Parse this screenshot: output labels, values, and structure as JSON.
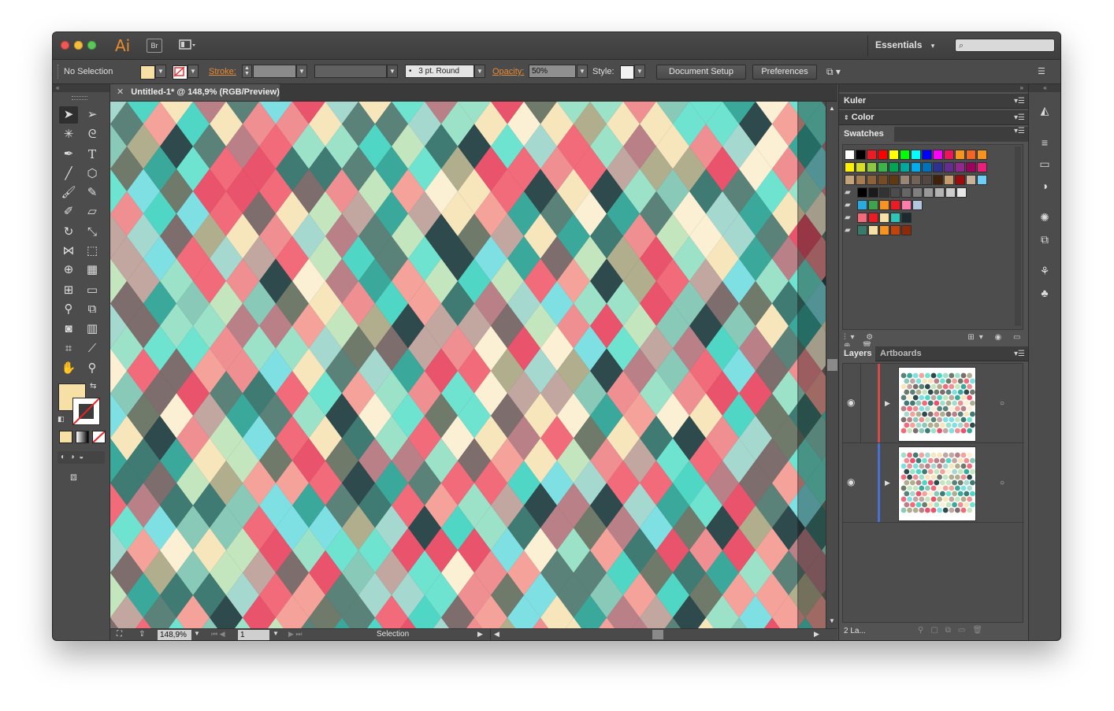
{
  "app": {
    "logo": "Ai",
    "bridge_label": "Br",
    "workspace": "Essentials",
    "workspace_arrow": "▾",
    "search_placeholder": ""
  },
  "control_bar": {
    "selection_status": "No Selection",
    "stroke_label": "Stroke:",
    "brush_label": "3 pt. Round",
    "opacity_label": "Opacity:",
    "opacity_value": "50%",
    "style_label": "Style:",
    "document_setup": "Document Setup",
    "preferences": "Preferences"
  },
  "document": {
    "tab_title": "Untitled-1* @ 148,9% (RGB/Preview)",
    "zoom": "148,9%",
    "artboard_number": "1",
    "status_tool": "Selection"
  },
  "panels": {
    "kuler": "Kuler",
    "color": "Color",
    "swatches": "Swatches",
    "layers_tab": "Layers",
    "artboards_tab": "Artboards",
    "layers_count": "2 La..."
  },
  "colors": {
    "fill_swatch": "#f6e0a5",
    "pattern": [
      "#f26b7a",
      "#ef8f92",
      "#f5a39a",
      "#e9536b",
      "#4fd6c4",
      "#6ee3d0",
      "#7fe0e4",
      "#9be2c9",
      "#c4e6be",
      "#f7e6bc",
      "#fbf0d4",
      "#c2a6a0",
      "#b98088",
      "#7d6d6d",
      "#5b8278",
      "#3f7a73",
      "#2f4a4d",
      "#6f7a6b",
      "#b1ae8e",
      "#3aa89a",
      "#88c9b8",
      "#a5d9d0"
    ],
    "swatch_rows": [
      [
        "#ffffff",
        "#000000",
        "#ed1c24",
        "#ff0000",
        "#ffff00",
        "#00ff00",
        "#00ffff",
        "#0000ff",
        "#ff00ff",
        "#ed145b",
        "#f7941d",
        "#f26522",
        "#f7941d"
      ],
      [
        "#fff200",
        "#d7df23",
        "#8dc63f",
        "#39b54a",
        "#00a651",
        "#00a99d",
        "#00aeef",
        "#0072bc",
        "#2e3192",
        "#662d91",
        "#92278f",
        "#9e005d",
        "#ed1e79"
      ],
      [
        "#c4a57a",
        "#a67c52",
        "#8c6239",
        "#754c24",
        "#603913",
        "#998675",
        "#736357",
        "#534741",
        "#42210b",
        "#c69c6d",
        "#9e0b0f",
        "#c7b299",
        "#6dcff6"
      ],
      [
        "#000000",
        "#1a1a1a",
        "#333333",
        "#4d4d4d",
        "#666666",
        "#808080",
        "#999999",
        "#b3b3b3",
        "#cccccc",
        "#e6e6e6"
      ],
      [
        "#29abe2",
        "#3fa34d",
        "#f7931e",
        "#ed1c24",
        "#ff7bac",
        "#b3c6e0"
      ],
      [
        "#f26b7a",
        "#ed1c24",
        "#f6e0a5",
        "#2ec4b6",
        "#1b2a2f"
      ],
      [
        "#3a7a6a",
        "#f6e0a5",
        "#f7931e",
        "#c1440e",
        "#8c2a0a"
      ]
    ]
  }
}
